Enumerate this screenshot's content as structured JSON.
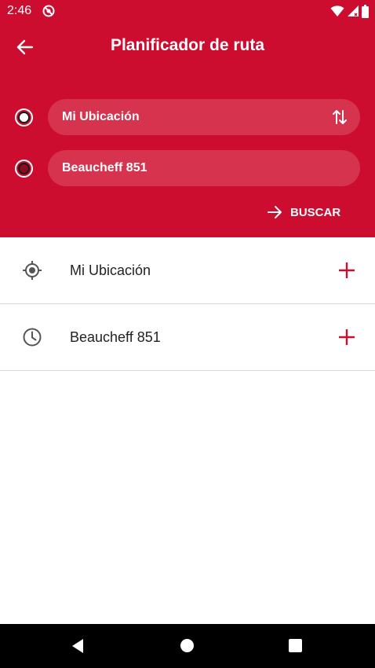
{
  "status_bar": {
    "time": "2:46"
  },
  "header": {
    "title": "Planificador de ruta",
    "origin_value": "Mi Ubicación",
    "destination_value": "Beaucheff 851",
    "search_label": "BUSCAR"
  },
  "list": {
    "items": [
      {
        "label": "Mi Ubicación",
        "icon": "my-location-icon"
      },
      {
        "label": "Beaucheff 851",
        "icon": "history-clock-icon"
      }
    ]
  },
  "colors": {
    "accent": "#CC0D2F",
    "field_bg": "#D6334E"
  }
}
